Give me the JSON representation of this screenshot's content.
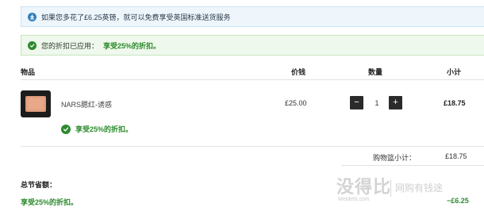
{
  "info_banner": {
    "text": "如果您多花了£6.25英镑，就可以免费享受英国标准送货服务",
    "icon": "download-icon"
  },
  "discount_banner": {
    "text": "您的折扣已应用：",
    "promo": "享受25%的折扣。",
    "icon": "check-circle-icon"
  },
  "table": {
    "headers": {
      "product": "物品",
      "price": "价钱",
      "quantity": "数量",
      "subtotal": "小计"
    }
  },
  "item": {
    "name": "NARS腮红-诱惑",
    "price": "£25.00",
    "quantity": "1",
    "subtotal": "£18.75",
    "promo": "享受25%的折扣。",
    "decrement_label": "−",
    "increment_label": "+"
  },
  "cart": {
    "subtotal_label": "购物篮小计：",
    "subtotal_value": "£18.75"
  },
  "savings": {
    "label": "总节省额：",
    "promo": "享受25%的折扣。",
    "value": "−£6.25"
  },
  "watermark": {
    "logo": "没得比",
    "site": "Meidebi.com",
    "slogan": "网购有钱途"
  },
  "colors": {
    "info_bg": "#eef6fc",
    "success_bg": "#eff8ec",
    "success_green": "#2c8a2c",
    "info_blue": "#2e7fc0"
  }
}
